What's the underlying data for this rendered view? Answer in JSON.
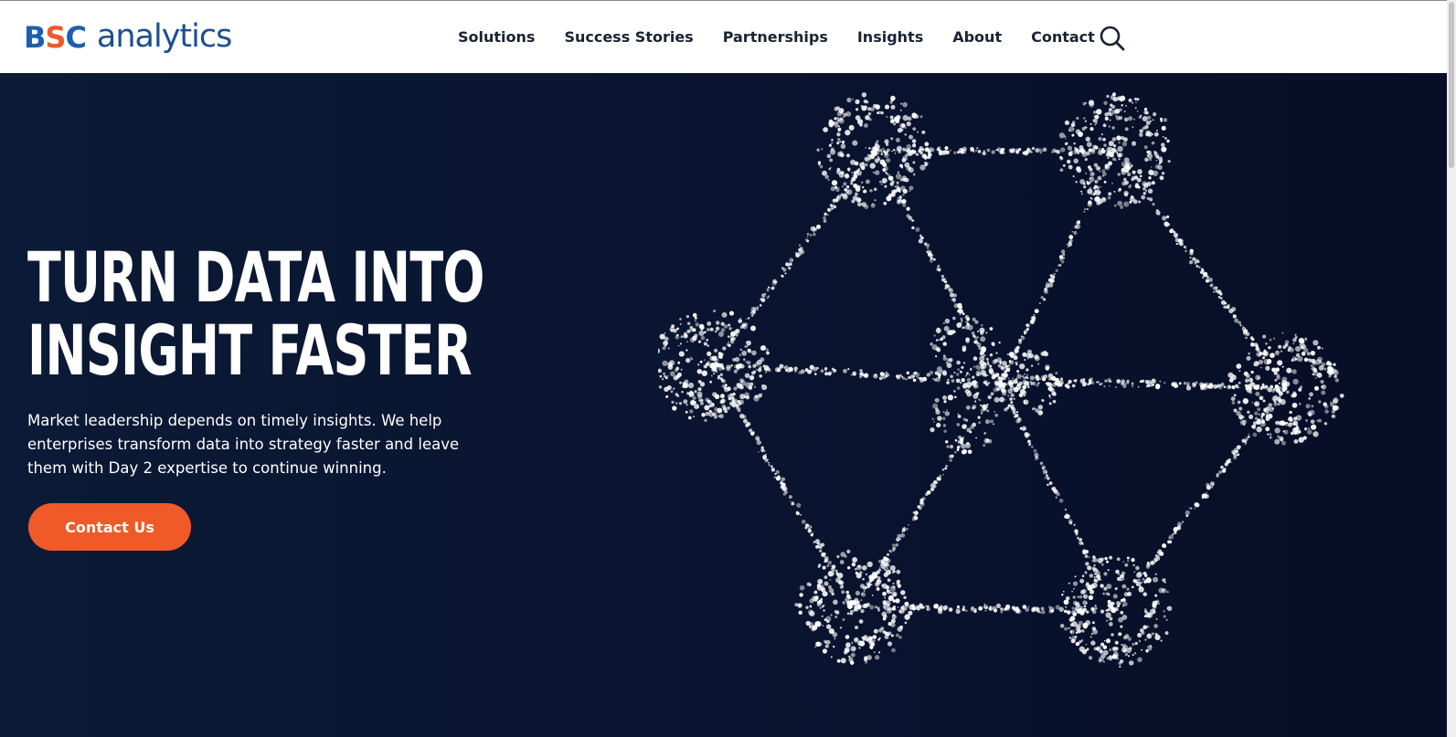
{
  "brand": {
    "mark_left": "B",
    "mark_mid": "S",
    "mark_right": "C",
    "wordmark": "analytics",
    "colors": {
      "blue": "#1d5fae",
      "orange": "#ef5a2b",
      "navy": "#1d4f8f"
    }
  },
  "nav": {
    "items": [
      {
        "label": "Solutions"
      },
      {
        "label": "Success Stories"
      },
      {
        "label": "Partnerships"
      },
      {
        "label": "Insights"
      },
      {
        "label": "About"
      },
      {
        "label": "Contact"
      }
    ],
    "search_icon": "search-icon"
  },
  "hero": {
    "title_line1": "TURN DATA INTO",
    "title_line2": "INSIGHT FASTER",
    "body": "Market leadership depends on timely insights. We help enterprises transform data into strategy faster and leave them with Day 2 expertise to continue winning.",
    "cta_label": "Contact Us",
    "colors": {
      "background": "#0a1531",
      "cta": "#f05a28"
    },
    "illustration": "particle-hexagon-network"
  }
}
